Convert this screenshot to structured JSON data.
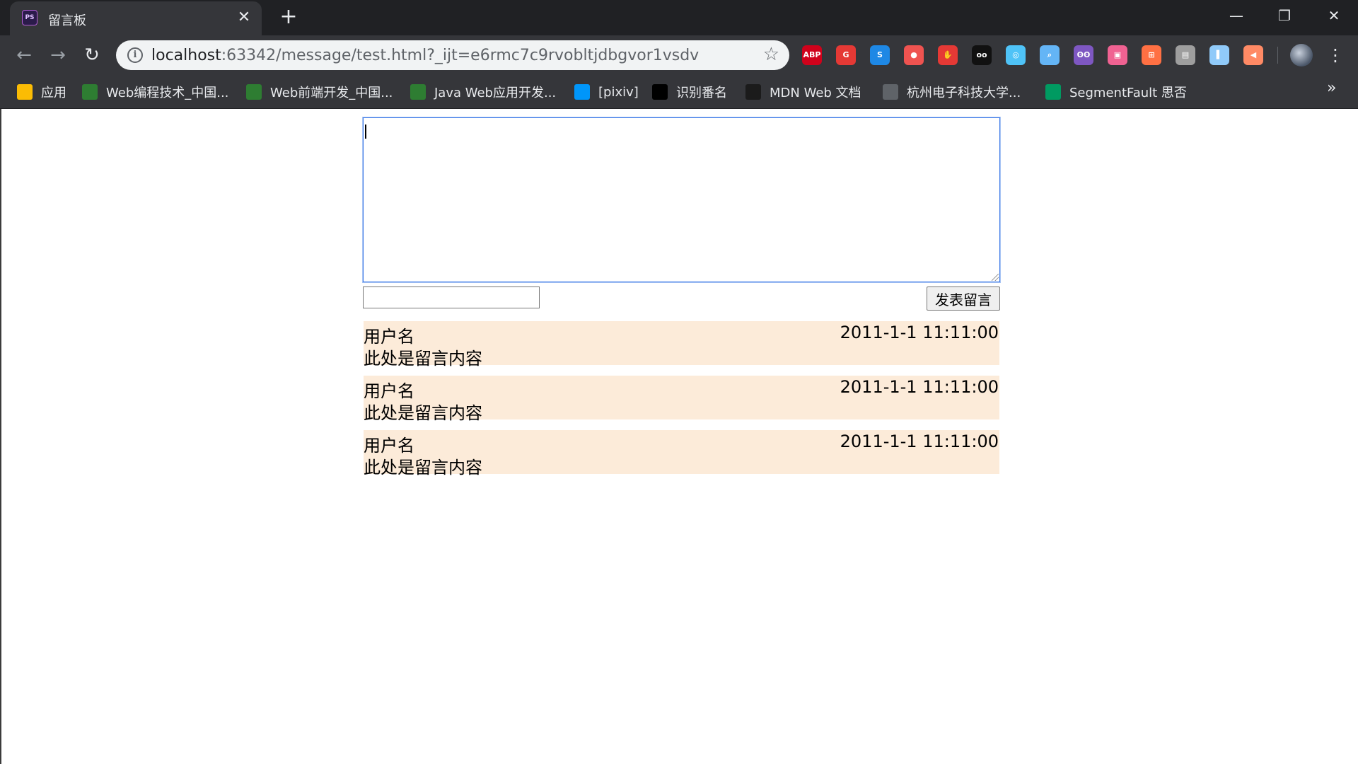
{
  "browser": {
    "tab_title": "留言板",
    "tab_favicon_text": "PS",
    "url_host": "localhost",
    "url_rest": ":63342/message/test.html?_ijt=e6rmc7c9rvobltjdbgvor1vsdv",
    "extensions": [
      {
        "name": "adblock-plus-icon",
        "label": "ABP",
        "color": "#d0021b"
      },
      {
        "name": "extension-red-g-icon",
        "label": "G",
        "color": "#e53935"
      },
      {
        "name": "extension-s-icon",
        "label": "S",
        "color": "#1e88e5"
      },
      {
        "name": "location-pin-icon",
        "label": "●",
        "color": "#ef5350"
      },
      {
        "name": "hand-stop-icon",
        "label": "✋",
        "color": "#e53935"
      },
      {
        "name": "glasses-icon",
        "label": "oo",
        "color": "#111111"
      },
      {
        "name": "circle-blue-icon",
        "label": "◎",
        "color": "#4fc3f7"
      },
      {
        "name": "search-magnifier-icon",
        "label": "⌕",
        "color": "#64b5f6"
      },
      {
        "name": "owl-icon",
        "label": "ʘʘ",
        "color": "#7e57c2"
      },
      {
        "name": "bilibili-tv-icon",
        "label": "▣",
        "color": "#f06292"
      },
      {
        "name": "gift-icon",
        "label": "⊞",
        "color": "#ff7043"
      },
      {
        "name": "card-icon",
        "label": "▤",
        "color": "#9e9e9e"
      },
      {
        "name": "bookmark-blue-icon",
        "label": "▌",
        "color": "#90caf9"
      },
      {
        "name": "speaker-icon",
        "label": "◀",
        "color": "#ff8a65"
      }
    ]
  },
  "bookmarks": [
    {
      "name": "bookmark-apps",
      "label": "应用",
      "icon": "apps-grid-icon",
      "icon_color": "#fbbc04"
    },
    {
      "name": "bookmark-web-programming",
      "label": "Web编程技术_中国...",
      "icon": "mooc-icon",
      "icon_color": "#2e7d32"
    },
    {
      "name": "bookmark-web-frontend",
      "label": "Web前端开发_中国...",
      "icon": "mooc-icon",
      "icon_color": "#2e7d32"
    },
    {
      "name": "bookmark-java-web",
      "label": "Java Web应用开发...",
      "icon": "mooc-icon",
      "icon_color": "#2e7d32"
    },
    {
      "name": "bookmark-pixiv",
      "label": "[pixiv]",
      "icon": "pixiv-icon",
      "icon_color": "#0096fa"
    },
    {
      "name": "bookmark-identify",
      "label": "识别番名",
      "icon": "terminal-icon",
      "icon_color": "#000000"
    },
    {
      "name": "bookmark-mdn",
      "label": "MDN Web 文档",
      "icon": "mdn-icon",
      "icon_color": "#1b1b1b"
    },
    {
      "name": "bookmark-hdu",
      "label": "杭州电子科技大学...",
      "icon": "globe-icon",
      "icon_color": "#5f6368"
    },
    {
      "name": "bookmark-segmentfault",
      "label": "SegmentFault 思否",
      "icon": "segmentfault-icon",
      "icon_color": "#009a61"
    }
  ],
  "form": {
    "textarea_value": "",
    "name_value": "",
    "submit_label": "发表留言"
  },
  "messages": [
    {
      "user": "用户名",
      "time": "2011-1-1 11:11:00",
      "content": "此处是留言内容"
    },
    {
      "user": "用户名",
      "time": "2011-1-1 11:11:00",
      "content": "此处是留言内容"
    },
    {
      "user": "用户名",
      "time": "2011-1-1 11:11:00",
      "content": "此处是留言内容"
    }
  ],
  "colors": {
    "message_bg": "#fcebd9",
    "chrome_dark": "#202124",
    "chrome_toolbar": "#35363a",
    "focus_border": "#3b78e7"
  }
}
